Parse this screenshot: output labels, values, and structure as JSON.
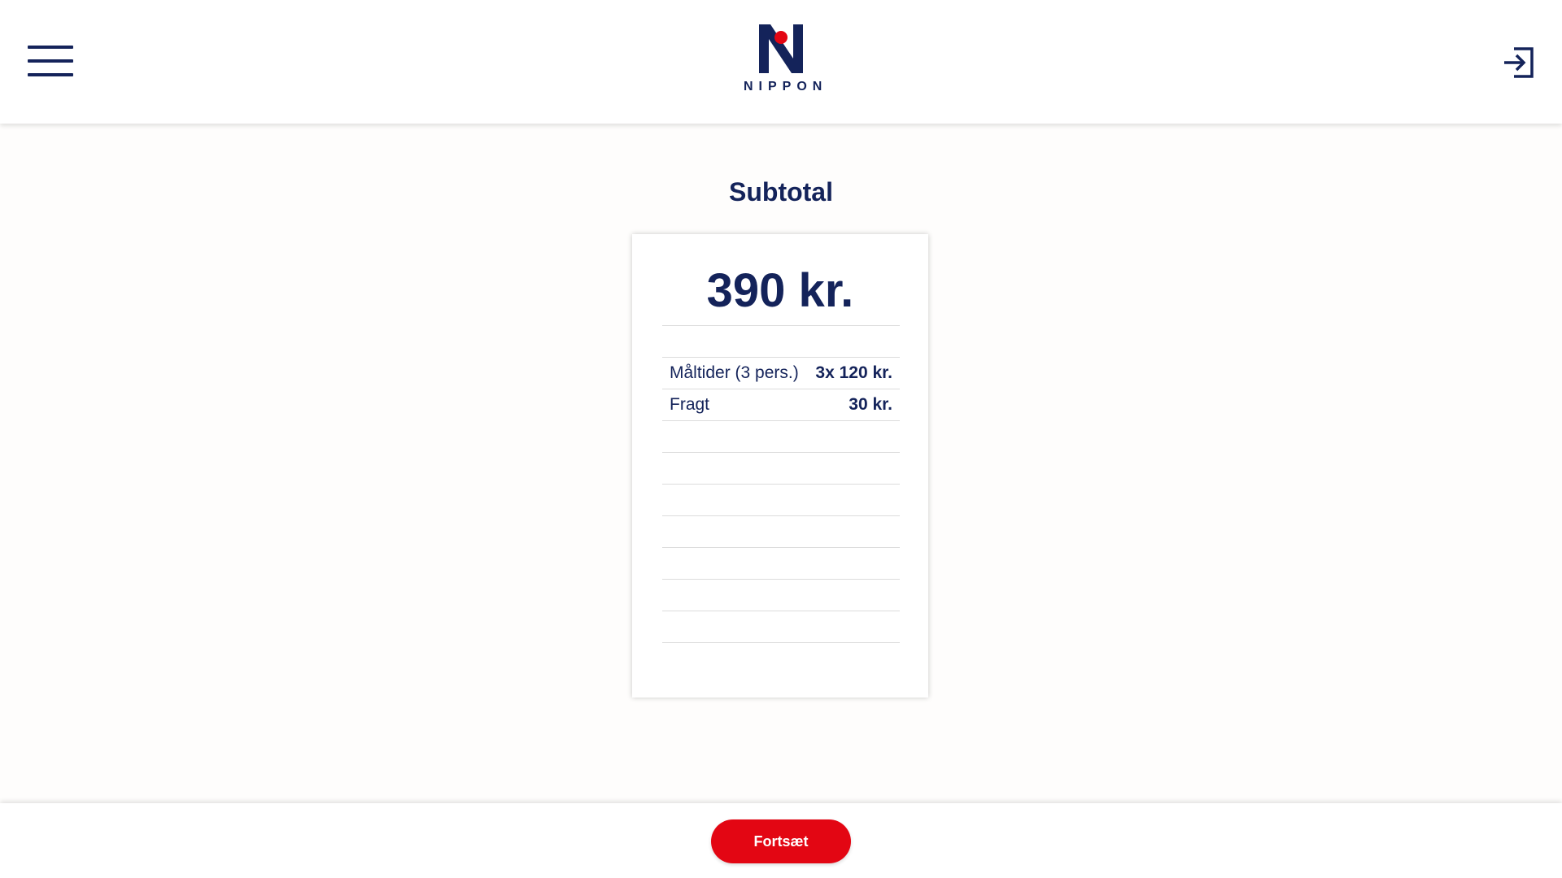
{
  "header": {
    "brand_name": "NIPPON",
    "menu_icon": "hamburger-menu-icon",
    "login_icon": "login-icon",
    "brand_blue": "#14235a",
    "brand_red": "#e30613"
  },
  "summary": {
    "title": "Subtotal",
    "total": "390 kr.",
    "items": [
      {
        "label": "Måltider (3 pers.)",
        "amount": "3x 120 kr."
      },
      {
        "label": "Fragt",
        "amount": "30 kr."
      }
    ]
  },
  "footer": {
    "continue_label": "Fortsæt",
    "button_color": "#e30613"
  }
}
